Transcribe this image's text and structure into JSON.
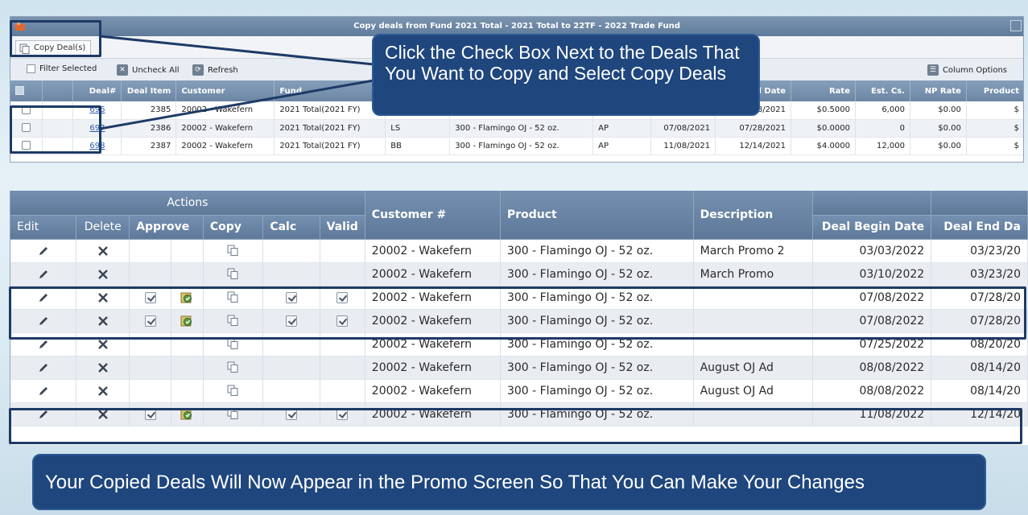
{
  "dialog": {
    "title": "Copy deals from Fund 2021 Total - 2021 Total to 22TF - 2022 Trade Fund",
    "copy_button": "Copy Deal(s)",
    "toolbar": {
      "filter_selected": "Filter Selected",
      "uncheck_all": "Uncheck All",
      "refresh": "Refresh",
      "column_options": "Column Options"
    },
    "columns": [
      "Deal#",
      "Deal Item",
      "Customer",
      "Fund",
      "",
      "",
      "",
      "",
      "nd Date",
      "Rate",
      "Est. Cs.",
      "NP Rate",
      "Product"
    ],
    "rows": [
      {
        "deal": "696",
        "item": "2385",
        "customer": "20002 - Wakefern",
        "fund": "2021 Total(2021 FY)",
        "code": "",
        "product": "",
        "type": "",
        "begin": "",
        "end": "/28/2021",
        "rate": "$0.5000",
        "cases": "6,000",
        "np": "$0.00",
        "prod": "$"
      },
      {
        "deal": "697",
        "item": "2386",
        "customer": "20002 - Wakefern",
        "fund": "2021 Total(2021 FY)",
        "code": "LS",
        "product": "300 - Flamingo OJ - 52 oz.",
        "type": "AP",
        "begin": "07/08/2021",
        "end": "07/28/2021",
        "rate": "$0.0000",
        "cases": "0",
        "np": "$0.00",
        "prod": "$"
      },
      {
        "deal": "698",
        "item": "2387",
        "customer": "20002 - Wakefern",
        "fund": "2021 Total(2021 FY)",
        "code": "BB",
        "product": "300 - Flamingo OJ - 52 oz.",
        "type": "AP",
        "begin": "11/08/2021",
        "end": "12/14/2021",
        "rate": "$4.0000",
        "cases": "12,000",
        "np": "$0.00",
        "prod": "$"
      }
    ]
  },
  "promo_grid": {
    "actions_header": "Actions",
    "columns": {
      "edit": "Edit",
      "delete": "Delete",
      "approve": "Approve",
      "copy": "Copy",
      "calc": "Calc",
      "valid": "Valid",
      "customer": "Customer #",
      "product": "Product",
      "description": "Description",
      "begin": "Deal Begin Date",
      "end": "Deal End Da"
    },
    "rows": [
      {
        "customer": "20002 - Wakefern",
        "product": "300 - Flamingo OJ - 52 oz.",
        "description": "March Promo 2",
        "begin": "03/03/2022",
        "end": "03/23/20",
        "approved": false
      },
      {
        "customer": "20002 - Wakefern",
        "product": "300 - Flamingo OJ - 52 oz.",
        "description": "March Promo",
        "begin": "03/10/2022",
        "end": "03/23/20",
        "approved": false
      },
      {
        "customer": "20002 - Wakefern",
        "product": "300 - Flamingo OJ - 52 oz.",
        "description": "",
        "begin": "07/08/2022",
        "end": "07/28/20",
        "approved": true
      },
      {
        "customer": "20002 - Wakefern",
        "product": "300 - Flamingo OJ - 52 oz.",
        "description": "",
        "begin": "07/08/2022",
        "end": "07/28/20",
        "approved": true
      },
      {
        "customer": "20002 - Wakefern",
        "product": "300 - Flamingo OJ - 52 oz.",
        "description": "",
        "begin": "07/25/2022",
        "end": "08/20/20",
        "approved": false
      },
      {
        "customer": "20002 - Wakefern",
        "product": "300 - Flamingo OJ - 52 oz.",
        "description": "August OJ Ad",
        "begin": "08/08/2022",
        "end": "08/14/20",
        "approved": false
      },
      {
        "customer": "20002 - Wakefern",
        "product": "300 - Flamingo OJ - 52 oz.",
        "description": "August OJ Ad",
        "begin": "08/08/2022",
        "end": "08/14/20",
        "approved": false
      },
      {
        "customer": "20002 - Wakefern",
        "product": "300 - Flamingo OJ - 52 oz.",
        "description": "",
        "begin": "11/08/2022",
        "end": "12/14/20",
        "approved": true
      }
    ]
  },
  "callouts": {
    "top": "Click the Check Box Next to the Deals That You Want to Copy and Select Copy Deals",
    "bottom": "Your Copied Deals Will Now Appear in the Promo Screen So That You Can Make Your Changes"
  },
  "colors": {
    "accent": "#1f467d",
    "header": "#6c86a4",
    "highlight_border": "#1d3a66"
  }
}
